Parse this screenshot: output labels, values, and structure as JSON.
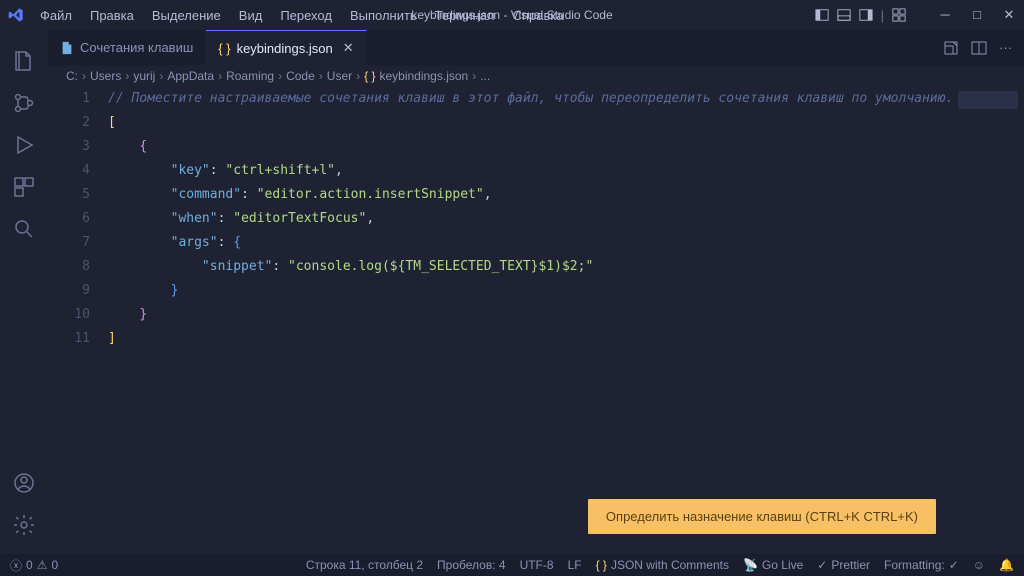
{
  "menu": [
    "Файл",
    "Правка",
    "Выделение",
    "Вид",
    "Переход",
    "Выполнить",
    "Терминал",
    "Справка"
  ],
  "window_title": "keybindings.json - Visual Studio Code",
  "tabs": [
    {
      "label": "Сочетания клавиш",
      "active": false
    },
    {
      "label": "keybindings.json",
      "active": true
    }
  ],
  "breadcrumbs": [
    "C:",
    "Users",
    "yurij",
    "AppData",
    "Roaming",
    "Code",
    "User",
    "keybindings.json",
    "..."
  ],
  "code": {
    "comment": "// Поместите настраиваемые сочетания клавиш в этот файл, чтобы переопределить сочетания клавиш по умолчанию.",
    "key_k": "\"key\"",
    "key_v": "\"ctrl+shift+l\"",
    "cmd_k": "\"command\"",
    "cmd_v": "\"editor.action.insertSnippet\"",
    "when_k": "\"when\"",
    "when_v": "\"editorTextFocus\"",
    "args_k": "\"args\"",
    "snip_k": "\"snippet\"",
    "snip_v": "\"console.log(${TM_SELECTED_TEXT}$1)$2;\""
  },
  "line_numbers": [
    "1",
    "2",
    "3",
    "4",
    "5",
    "6",
    "7",
    "8",
    "9",
    "10",
    "11"
  ],
  "notification": "Определить назначение клавиш (CTRL+K CTRL+K)",
  "status": {
    "errors": "0",
    "warnings": "0",
    "ln_col": "Строка 11, столбец 2",
    "spaces": "Пробелов: 4",
    "encoding": "UTF-8",
    "eol": "LF",
    "lang": "JSON with Comments",
    "golive": "Go Live",
    "prettier": "Prettier",
    "formatting": "Formatting:"
  }
}
